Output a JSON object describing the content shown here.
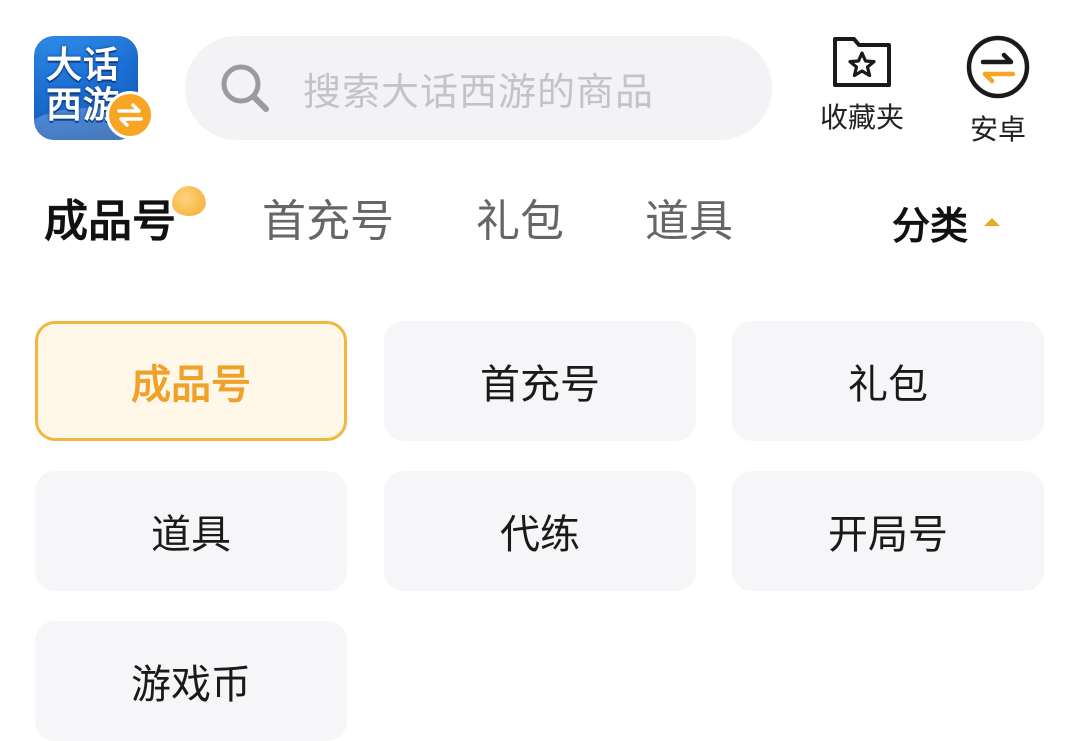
{
  "header": {
    "app_icon": {
      "text": "大话西游",
      "badge_icon": "swap-arrows-icon",
      "badge_color": "#f6a623",
      "bg_color": "#1c6fd6"
    },
    "search": {
      "icon": "search-icon",
      "placeholder": "搜索大话西游的商品"
    },
    "favorites": {
      "icon": "folder-star-icon",
      "label": "收藏夹"
    },
    "platform": {
      "icon": "swap-circle-icon",
      "label": "安卓"
    }
  },
  "tabs": [
    {
      "label": "成品号",
      "active": true
    },
    {
      "label": "首充号",
      "active": false
    },
    {
      "label": "礼包",
      "active": false
    },
    {
      "label": "道具",
      "active": false
    }
  ],
  "category_toggle": {
    "label": "分类",
    "icon": "caret-up-icon",
    "color": "#f6a623"
  },
  "categories": [
    {
      "label": "成品号",
      "selected": true
    },
    {
      "label": "首充号",
      "selected": false
    },
    {
      "label": "礼包",
      "selected": false
    },
    {
      "label": "道具",
      "selected": false
    },
    {
      "label": "代练",
      "selected": false
    },
    {
      "label": "开局号",
      "selected": false
    },
    {
      "label": "游戏币",
      "selected": false
    }
  ],
  "colors": {
    "accent": "#f6a623",
    "selected_border": "#f3b63f",
    "selected_text": "#f0a12a",
    "chip_bg": "#f6f6f8"
  }
}
